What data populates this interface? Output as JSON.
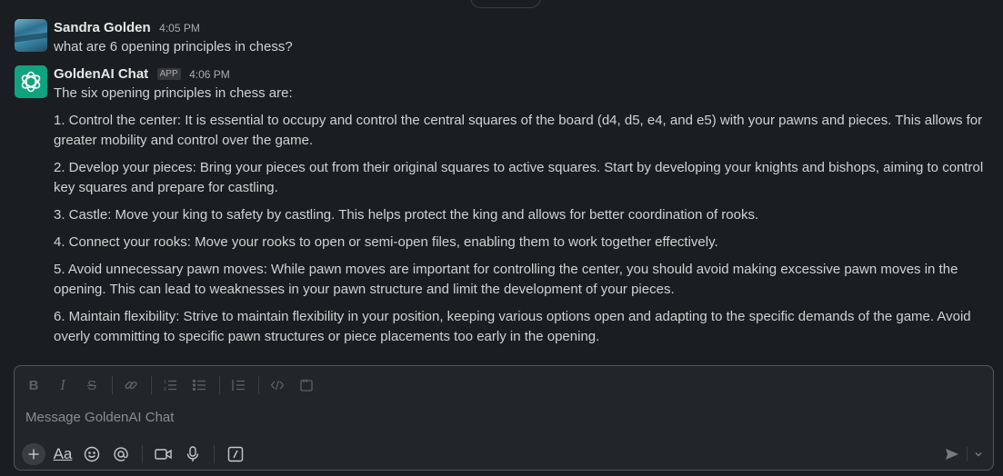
{
  "messages": [
    {
      "sender": "Sandra Golden",
      "time": "4:05 PM",
      "paragraphs": [
        "what are 6 opening principles in chess?"
      ]
    },
    {
      "sender": "GoldenAI Chat",
      "badge": "APP",
      "time": "4:06 PM",
      "paragraphs": [
        "The six opening principles in chess are:",
        "1. Control the center: It is essential to occupy and control the central squares of the board (d4, d5, e4, and e5) with your pawns and pieces. This allows for greater mobility and control over the game.",
        "2. Develop your pieces: Bring your pieces out from their original squares to active squares. Start by developing your knights and bishops, aiming to control key squares and prepare for castling.",
        "3. Castle: Move your king to safety by castling. This helps protect the king and allows for better coordination of rooks.",
        "4. Connect your rooks: Move your rooks to open or semi-open files, enabling them to work together effectively.",
        "5. Avoid unnecessary pawn moves: While pawn moves are important for controlling the center, you should avoid making excessive pawn moves in the opening. This can lead to weaknesses in your pawn structure and limit the development of your pieces.",
        "6. Maintain flexibility: Strive to maintain flexibility in your position, keeping various options open and adapting to the specific demands of the game. Avoid overly committing to specific pawn structures or piece placements too early in the opening."
      ]
    }
  ],
  "composer": {
    "placeholder": "Message GoldenAI Chat",
    "formatting_tools": [
      "bold-icon",
      "italic-icon",
      "strikethrough-icon",
      "link-icon",
      "ordered-list-icon",
      "bulleted-list-icon",
      "blockquote-icon",
      "code-icon",
      "code-block-icon"
    ],
    "actions": [
      "plus-icon",
      "text-format-icon",
      "emoji-icon",
      "mention-icon",
      "video-icon",
      "microphone-icon",
      "slash-command-icon"
    ],
    "format_label": "Aa"
  },
  "colors": {
    "background": "#1a1d21",
    "composer_bg": "#222529",
    "bot_avatar": "#10a37f",
    "text": "#d1d2d3"
  }
}
